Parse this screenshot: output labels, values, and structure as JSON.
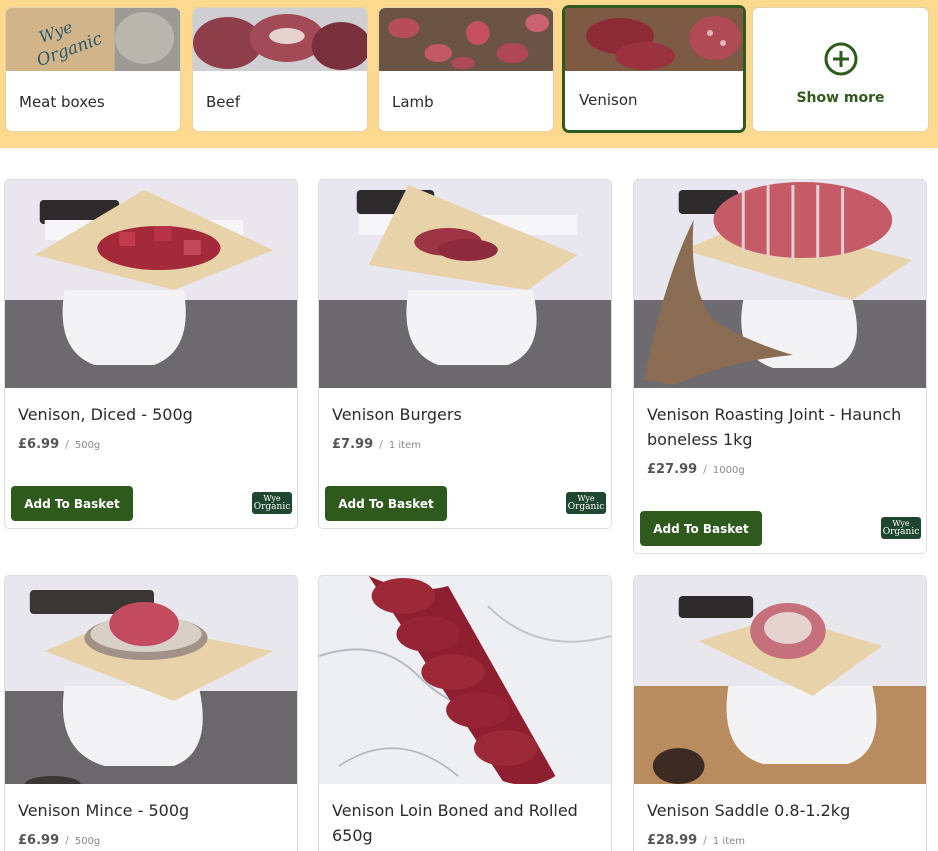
{
  "categories": [
    {
      "label": "Meat boxes",
      "active": false,
      "image": "wye-organic-box-photo"
    },
    {
      "label": "Beef",
      "active": false,
      "image": "beef-cuts-photo"
    },
    {
      "label": "Lamb",
      "active": false,
      "image": "lamb-cuts-photo"
    },
    {
      "label": "Venison",
      "active": true,
      "image": "venison-cuts-photo"
    }
  ],
  "show_more": {
    "label": "Show more",
    "icon": "plus-circle-icon"
  },
  "products": [
    {
      "title": "Venison, Diced - 500g",
      "price": "£6.99",
      "unit": "500g",
      "button": "Add To Basket",
      "badge": "Wye Organic"
    },
    {
      "title": "Venison Burgers",
      "price": "£7.99",
      "unit": "1 item",
      "button": "Add To Basket",
      "badge": "Wye Organic"
    },
    {
      "title": "Venison Roasting Joint - Haunch boneless 1kg",
      "price": "£27.99",
      "unit": "1000g",
      "button": "Add To Basket",
      "badge": "Wye Organic"
    },
    {
      "title": "Venison Mince - 500g",
      "price": "£6.99",
      "unit": "500g"
    },
    {
      "title": "Venison Loin Boned and Rolled 650g",
      "price": "",
      "unit": ""
    },
    {
      "title": "Venison Saddle 0.8-1.2kg",
      "price": "£28.99",
      "unit": "1 item"
    }
  ],
  "colors": {
    "brand_green": "#2f5a1e",
    "strip_bg": "#fcd98e",
    "badge_bg": "#1f4630"
  }
}
